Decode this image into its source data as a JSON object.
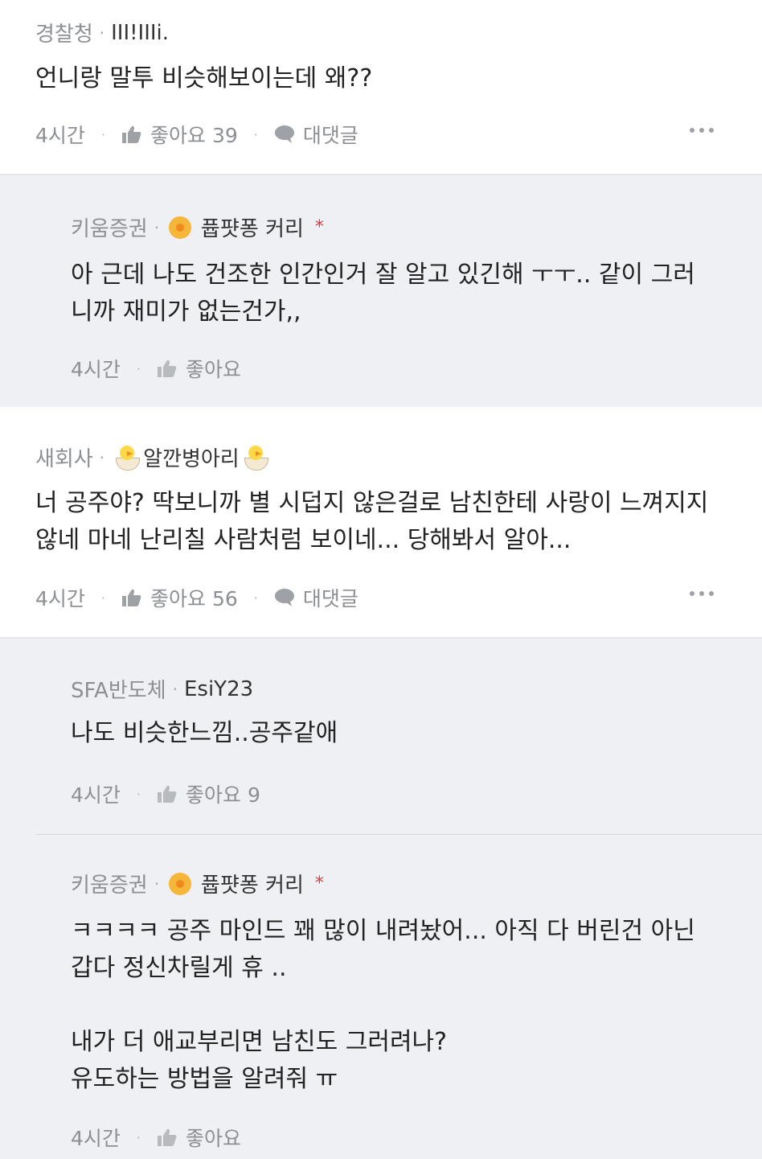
{
  "comments": [
    {
      "company": "경찰청",
      "nickname": "III!IIIi.",
      "text": "언니랑 말투 비슷해보이는데 왜??",
      "time": "4시간",
      "like_label": "좋아요 39",
      "reply_label": "대댓글"
    },
    {
      "company": "키움증권",
      "nickname": "퓹퍗퐁 커리",
      "star": "*",
      "text": "아 근데 나도 건조한 인간인거 잘 알고 있긴해 ㅜㅜ.. 같이 그러\n니까 재미가 없는건가,,",
      "time": "4시간",
      "like_label": "좋아요"
    },
    {
      "company": "새회사",
      "nickname": "알깐병아리",
      "text": "너 공주야? 딱보니까 별 시덥지 않은걸로 남친한테 사랑이 느껴지지\n않네 마네 난리칠 사람처럼 보이네... 당해봐서 알아...",
      "time": "4시간",
      "like_label": "좋아요 56",
      "reply_label": "대댓글"
    },
    {
      "company": "SFA반도체",
      "nickname": "EsiY23",
      "text": "나도 비슷한느낌..공주같애",
      "time": "4시간",
      "like_label": "좋아요 9"
    },
    {
      "company": "키움증권",
      "nickname": "퓹퍗퐁 커리",
      "star": "*",
      "text": "ㅋㅋㅋㅋ 공주 마인드 꽤 많이 내려놨어... 아직 다 버린건 아닌\n갑다 정신차릴게 휴 ..\n\n내가 더 애교부리면 남친도 그러려나?\n유도하는 방법을 알려줘 ㅠ",
      "time": "4시간",
      "like_label": "좋아요"
    }
  ]
}
